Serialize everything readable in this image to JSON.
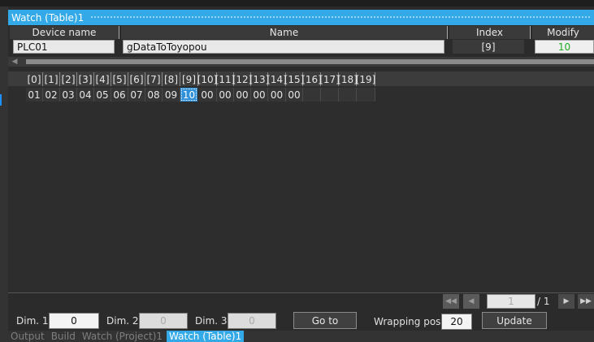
{
  "window": {
    "title": "Watch (Table)1"
  },
  "table": {
    "headers": {
      "device": "Device name",
      "name": "Name",
      "index": "Index",
      "modify": "Modify"
    },
    "row": {
      "device": "PLC01",
      "name": "gDataToToyopou",
      "index": "[9]",
      "modify": "10"
    }
  },
  "array_view": {
    "indices": [
      "[0]",
      "[1]",
      "[2]",
      "[3]",
      "[4]",
      "[5]",
      "[6]",
      "[7]",
      "[8]",
      "[9]",
      "[10]",
      "[11]",
      "[12]",
      "[13]",
      "[14]",
      "[15]",
      "[16]",
      "[17]",
      "[18]",
      "[19]"
    ],
    "values": [
      "01",
      "02",
      "03",
      "04",
      "05",
      "06",
      "07",
      "08",
      "09",
      "10",
      "00",
      "00",
      "00",
      "00",
      "00",
      "00",
      "",
      "",
      "",
      ""
    ],
    "selected_index": 9
  },
  "pager": {
    "current": "1",
    "total": "/ 1"
  },
  "controls": {
    "dim1_label": "Dim. 1",
    "dim1_value": "0",
    "dim2_label": "Dim. 2",
    "dim2_value": "0",
    "dim3_label": "Dim. 3",
    "dim3_value": "0",
    "goto_label": "Go to",
    "wrap_label": "Wrapping pos.",
    "wrap_value": "20",
    "update_label": "Update"
  },
  "tabs": [
    "Output",
    "Build",
    "Watch (Project)1",
    "Watch (Table)1"
  ],
  "active_tab": 3,
  "colors": {
    "accent": "#33a9e8",
    "modify_value": "#22aa22",
    "selection": "#2f8fd8"
  }
}
